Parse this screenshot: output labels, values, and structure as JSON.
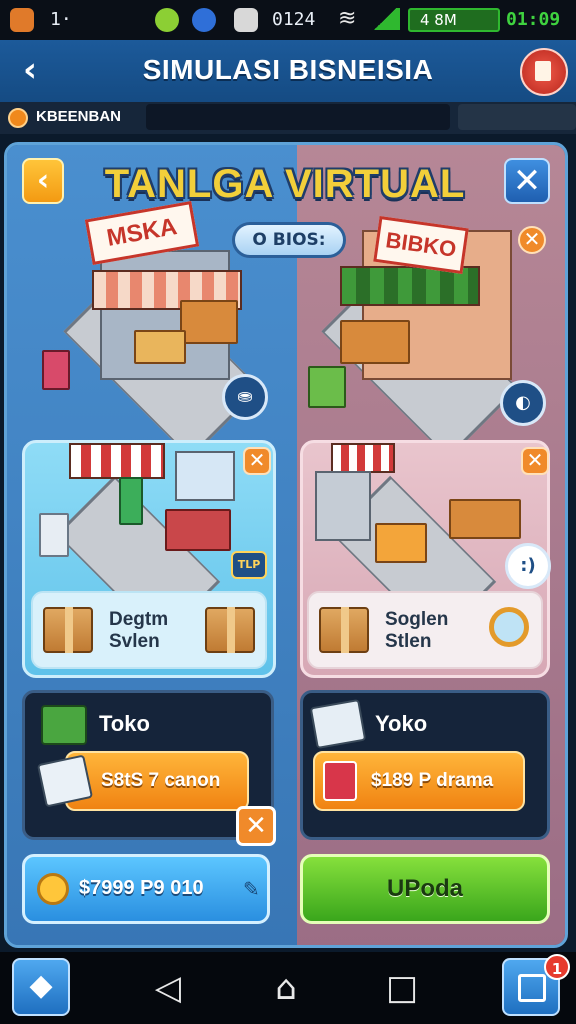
{
  "status_bar": {
    "left_text": "1·",
    "time_text": "0124",
    "battery_text": "4 8M",
    "clock": "01:09",
    "battery_color": "#2fb82f"
  },
  "header": {
    "title": "SIMULASI BISNEISIA",
    "back_icon": "chevron-left",
    "menu_icon": "document-icon"
  },
  "subbar": {
    "label": "KBEENBAN",
    "coin_color": "#f0891c"
  },
  "panel": {
    "title": "TANLGA VIRTUAL",
    "pill": "O BIOS:",
    "title_color": "#f2cf3a",
    "left_color": "#4a8fcf",
    "right_color": "#b68796"
  },
  "shops": {
    "left_top_sign": "MSKA",
    "right_top_sign": "BIBKO",
    "left_mid_badge": "TLP"
  },
  "info": {
    "left_line1": "Degtm",
    "left_line2": "Svlen",
    "right_line1": "Soglen",
    "right_line2": "Stlen"
  },
  "cards": {
    "left_label": "Toko",
    "left_button": "S8tS 7 canon",
    "right_label": "Yoko",
    "right_button": "$189 P drama"
  },
  "bottom": {
    "left_button": "$7999 P9 010",
    "right_button": "UPoda"
  },
  "nav": {
    "notification_count": "1"
  }
}
